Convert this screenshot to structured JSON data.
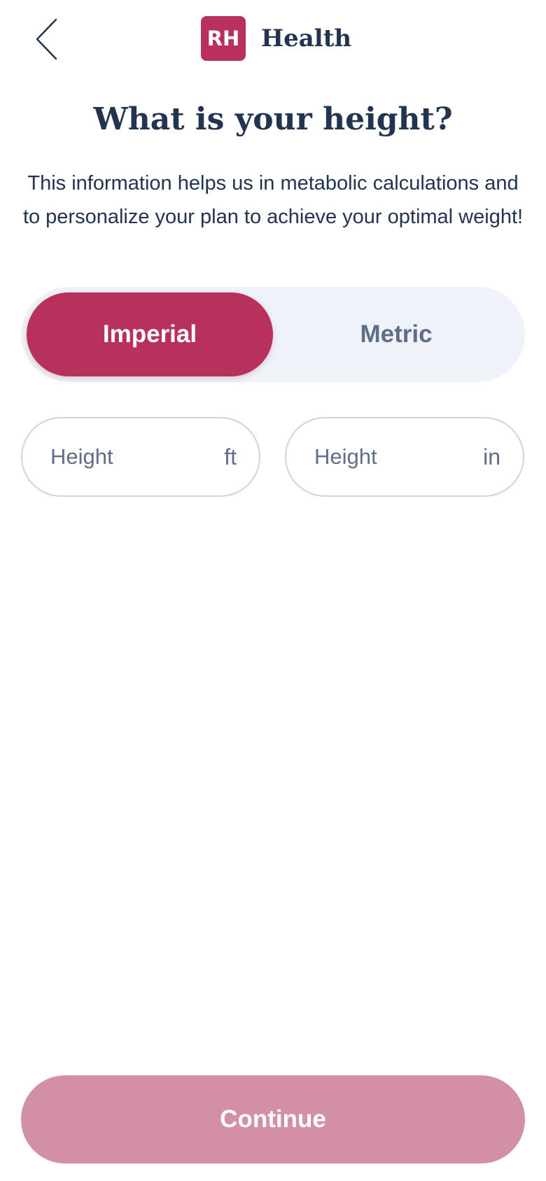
{
  "header": {
    "back_icon": "chevron-left-icon",
    "logo_text": "RH",
    "brand_name": "Health"
  },
  "title": "What is your height?",
  "subtitle": "This information helps us in metabolic calculations and to personalize your plan to achieve your optimal weight!",
  "unit_toggle": {
    "options": [
      "Imperial",
      "Metric"
    ],
    "selected": "Imperial"
  },
  "fields": {
    "feet": {
      "placeholder": "Height",
      "unit": "ft",
      "value": ""
    },
    "inches": {
      "placeholder": "Height",
      "unit": "in",
      "value": ""
    }
  },
  "continue_label": "Continue",
  "colors": {
    "brand": "#b8315c",
    "text_dark": "#22344f",
    "text_muted": "#5f6e86",
    "toggle_bg": "#eff2f8",
    "continue_disabled": "#d48fa8"
  }
}
